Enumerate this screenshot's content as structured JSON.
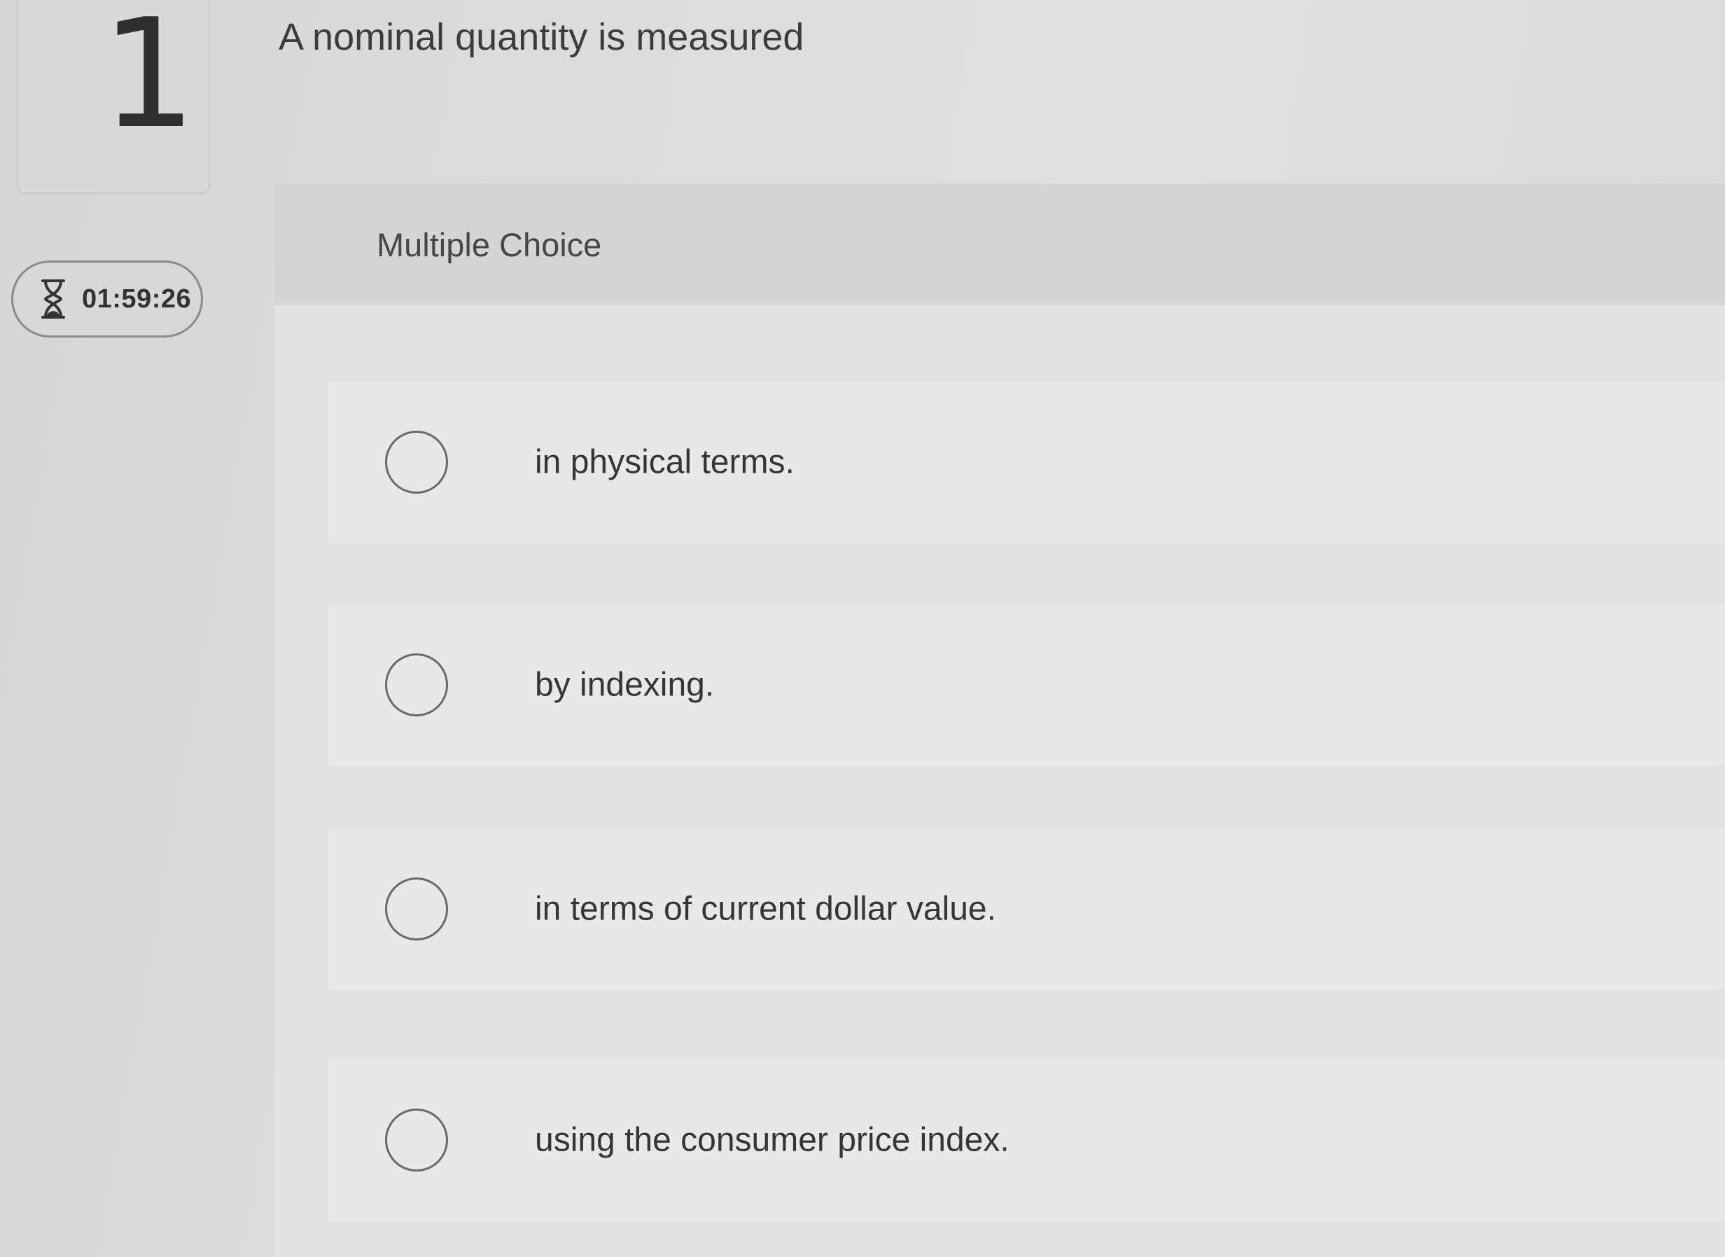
{
  "question_number": "1",
  "timer": {
    "icon": "hourglass-icon",
    "value": "01:59:26"
  },
  "question": {
    "text": "A nominal quantity is measured"
  },
  "question_type": "Multiple Choice",
  "options": [
    {
      "label": "in physical terms.",
      "selected": false
    },
    {
      "label": "by indexing.",
      "selected": false
    },
    {
      "label": "in terms of current dollar value.",
      "selected": false
    },
    {
      "label": "using the consumer price index.",
      "selected": false
    }
  ]
}
